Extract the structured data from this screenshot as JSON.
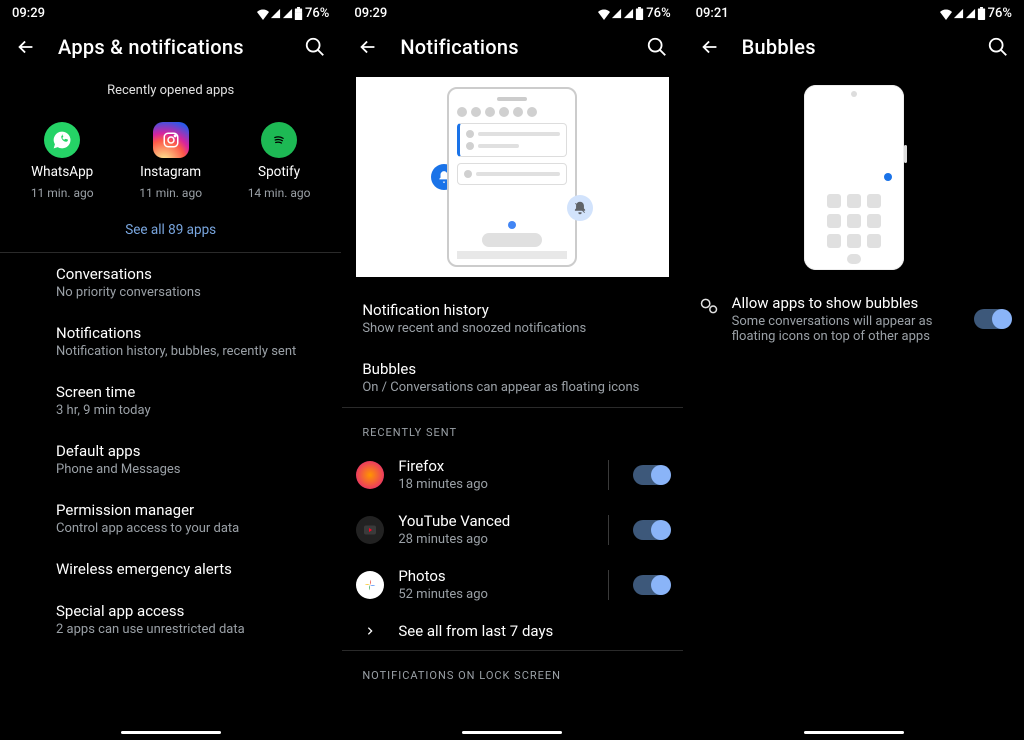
{
  "screen1": {
    "time": "09:29",
    "battery": "76%",
    "title": "Apps & notifications",
    "recentHeader": "Recently opened apps",
    "apps": [
      {
        "name": "WhatsApp",
        "sub": "11 min. ago"
      },
      {
        "name": "Instagram",
        "sub": "11 min. ago"
      },
      {
        "name": "Spotify",
        "sub": "14 min. ago"
      }
    ],
    "seeAll": "See all 89 apps",
    "items": [
      {
        "title": "Conversations",
        "sub": "No priority conversations"
      },
      {
        "title": "Notifications",
        "sub": "Notification history, bubbles, recently sent"
      },
      {
        "title": "Screen time",
        "sub": "3 hr, 9 min today"
      },
      {
        "title": "Default apps",
        "sub": "Phone and Messages"
      },
      {
        "title": "Permission manager",
        "sub": "Control app access to your data"
      },
      {
        "title": "Wireless emergency alerts",
        "sub": ""
      },
      {
        "title": "Special app access",
        "sub": "2 apps can use unrestricted data"
      }
    ]
  },
  "screen2": {
    "time": "09:29",
    "battery": "76%",
    "title": "Notifications",
    "top": [
      {
        "title": "Notification history",
        "sub": "Show recent and snoozed notifications"
      },
      {
        "title": "Bubbles",
        "sub": "On / Conversations can appear as floating icons"
      }
    ],
    "recentHeader": "Recently sent",
    "recent": [
      {
        "name": "Firefox",
        "sub": "18 minutes ago"
      },
      {
        "name": "YouTube Vanced",
        "sub": "28 minutes ago"
      },
      {
        "name": "Photos",
        "sub": "52 minutes ago"
      }
    ],
    "seeAll": "See all from last 7 days",
    "lockHeader": "Notifications on lock screen"
  },
  "screen3": {
    "time": "09:21",
    "battery": "76%",
    "title": "Bubbles",
    "setting": {
      "title": "Allow apps to show bubbles",
      "sub": "Some conversations will appear as floating icons on top of other apps"
    }
  }
}
